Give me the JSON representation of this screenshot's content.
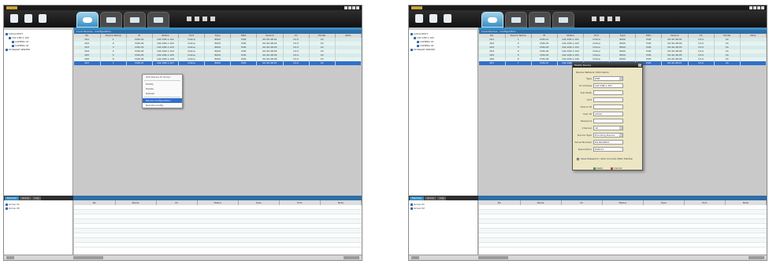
{
  "left": {
    "tree": [
      "LOCALHOST",
      "192.168.1.100",
      "CAMERA 01",
      "CAMERA 02",
      "STORAGE SERVER"
    ],
    "main_title": "Local Devices · Configuration",
    "columns": [
      "No",
      "Device Name",
      "IP",
      "Status",
      "Port",
      "Type",
      "MAC",
      "Version",
      "Ch",
      "Model",
      "Note"
    ],
    "rows": [
      [
        "001",
        "1",
        "DVR-01",
        "192.168.1.101",
        "Online",
        "8000",
        "DVR",
        "00:40:48:01",
        "V2.0",
        "16",
        ""
      ],
      [
        "002",
        "2",
        "DVR-02",
        "192.168.1.102",
        "Online",
        "8000",
        "DVR",
        "00:40:48:02",
        "V2.0",
        "16",
        ""
      ],
      [
        "003",
        "3",
        "DVR-03",
        "192.168.1.103",
        "Online",
        "8000",
        "DVR",
        "00:40:48:03",
        "V2.0",
        "16",
        ""
      ],
      [
        "004",
        "4",
        "DVR-04",
        "192.168.1.104",
        "Online",
        "8000",
        "DVR",
        "00:40:48:04",
        "V2.0",
        "16",
        ""
      ],
      [
        "005",
        "5",
        "DVR-05",
        "192.168.1.105",
        "Online",
        "8000",
        "DVR",
        "00:40:48:05",
        "V2.0",
        "16",
        ""
      ],
      [
        "006",
        "6",
        "DVR-06",
        "192.168.1.106",
        "Online",
        "8000",
        "DVR",
        "00:40:48:06",
        "V2.0",
        "16",
        ""
      ]
    ],
    "selected_row": [
      "007",
      "7",
      "DVR-07",
      "192.168.1.107",
      "Online",
      "8000",
      "DVR",
      "00:40:48:07",
      "V2.0",
      "16",
      ""
    ],
    "context_menu": [
      "Add Device To Group",
      "Modify",
      "Delete",
      "Refresh",
      "Device Configuration",
      "Remote Config"
    ],
    "bottom_tabs": [
      "Devices",
      "Group",
      "Log"
    ],
    "bottom_tree": [
      "Group 01",
      "Group 02"
    ],
    "bottom_columns": [
      "No",
      "Name",
      "Ch",
      "Status",
      "Type",
      "Port",
      "Note"
    ]
  },
  "right": {
    "tree": [
      "LOCALHOST",
      "192.168.1.100",
      "CAMERA 01",
      "CAMERA 02",
      "STORAGE SERVER"
    ],
    "main_title": "Local Devices · Configuration",
    "columns": [
      "No",
      "Device Name",
      "IP",
      "Status",
      "Port",
      "Type",
      "MAC",
      "Version",
      "Ch",
      "Model",
      "Note"
    ],
    "rows": [
      [
        "001",
        "1",
        "DVR-01",
        "192.168.1.101",
        "Online",
        "8000",
        "DVR",
        "00:40:48:01",
        "V2.0",
        "16",
        ""
      ],
      [
        "002",
        "2",
        "DVR-02",
        "192.168.1.102",
        "Online",
        "8000",
        "DVR",
        "00:40:48:02",
        "V2.0",
        "16",
        ""
      ],
      [
        "003",
        "3",
        "DVR-03",
        "192.168.1.103",
        "Online",
        "8000",
        "DVR",
        "00:40:48:03",
        "V2.0",
        "16",
        ""
      ],
      [
        "004",
        "4",
        "DVR-04",
        "192.168.1.104",
        "Online",
        "8000",
        "DVR",
        "00:40:48:04",
        "V2.0",
        "16",
        ""
      ],
      [
        "005",
        "5",
        "DVR-05",
        "192.168.1.105",
        "Online",
        "8000",
        "DVR",
        "00:40:48:05",
        "V2.0",
        "16",
        ""
      ],
      [
        "006",
        "6",
        "DVR-06",
        "192.168.1.106",
        "Online",
        "8000",
        "DVR",
        "00:40:48:06",
        "V2.0",
        "16",
        ""
      ]
    ],
    "selected_row": [
      "007",
      "7",
      "DVR-07",
      "192.168.1.107",
      "Online",
      "8000",
      "DVR",
      "00:40:48:07",
      "V2.0",
      "16",
      ""
    ],
    "dialog": {
      "title": "Modify Device",
      "header": "Device Network Information",
      "fields": [
        {
          "label": "Type",
          "value": "DVR",
          "dropdown": true
        },
        {
          "label": "IP Address",
          "value": "192.168.1.107",
          "dropdown": false
        },
        {
          "label": "Sub Mask",
          "value": "",
          "dropdown": false
        },
        {
          "label": "Port",
          "value": "",
          "dropdown": false
        },
        {
          "label": "Device ID",
          "value": "",
          "dropdown": false
        },
        {
          "label": "User ID",
          "value": "admin",
          "dropdown": false
        },
        {
          "label": "Password",
          "value": "",
          "dropdown": false
        },
        {
          "label": "Channel",
          "value": "16",
          "dropdown": true
        },
        {
          "label": "Device Type",
          "value": "Encoding Device",
          "dropdown": true
        },
        {
          "label": "Serial Number",
          "value": "DS-8016HCI",
          "dropdown": false
        },
        {
          "label": "Description",
          "value": "DVR-07",
          "dropdown": false
        }
      ],
      "check_label": "Save Password / Auto Connect After Startup",
      "ok_label": "Apply",
      "cancel_label": "Cancel"
    },
    "bottom_tabs": [
      "Devices",
      "Group",
      "Log"
    ],
    "bottom_tree": [
      "Group 01",
      "Group 02"
    ],
    "bottom_columns": [
      "No",
      "Name",
      "Ch",
      "Status",
      "Type",
      "Port",
      "Note"
    ]
  }
}
